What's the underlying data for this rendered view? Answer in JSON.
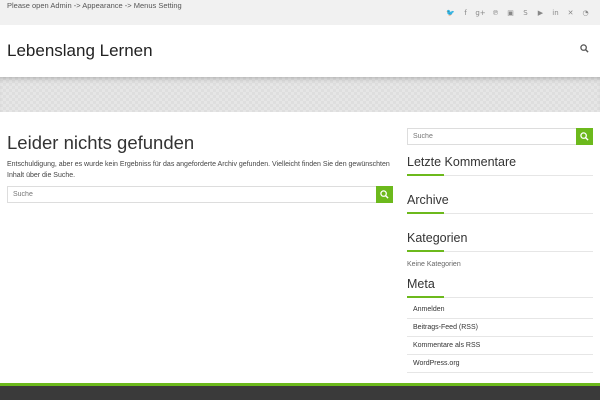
{
  "topbar": {
    "notice": "Please open Admin -> Appearance -> Menus Setting",
    "social_icons": [
      {
        "name": "twitter-icon",
        "glyph": "🐦"
      },
      {
        "name": "facebook-icon",
        "glyph": "f"
      },
      {
        "name": "googleplus-icon",
        "glyph": "g+"
      },
      {
        "name": "pinterest-icon",
        "glyph": "℗"
      },
      {
        "name": "flickr-icon",
        "glyph": "▣"
      },
      {
        "name": "skype-icon",
        "glyph": "S"
      },
      {
        "name": "youtube-icon",
        "glyph": "▶"
      },
      {
        "name": "linkedin-icon",
        "glyph": "in"
      },
      {
        "name": "xing-icon",
        "glyph": "✕"
      },
      {
        "name": "rss-icon",
        "glyph": "◔"
      }
    ]
  },
  "header": {
    "site_title": "Lebenslang Lernen"
  },
  "main": {
    "title": "Leider nichts gefunden",
    "notice": "Entschuldigung, aber es wurde kein Ergebniss für das angeforderte Archiv gefunden. Vielleicht finden Sie den gewünschten Inhalt über die Suche.",
    "search_placeholder": "Suche"
  },
  "sidebar": {
    "search_placeholder": "Suche",
    "recent_comments_title": "Letzte Kommentare",
    "archive_title": "Archive",
    "categories_title": "Kategorien",
    "no_categories": "Keine Kategorien",
    "meta_title": "Meta",
    "meta_links": [
      "Anmelden",
      "Beitrags-Feed (RSS)",
      "Kommentare als RSS",
      "WordPress.org"
    ]
  },
  "colors": {
    "accent": "#6cb91c",
    "footer": "#3a3a3a"
  }
}
